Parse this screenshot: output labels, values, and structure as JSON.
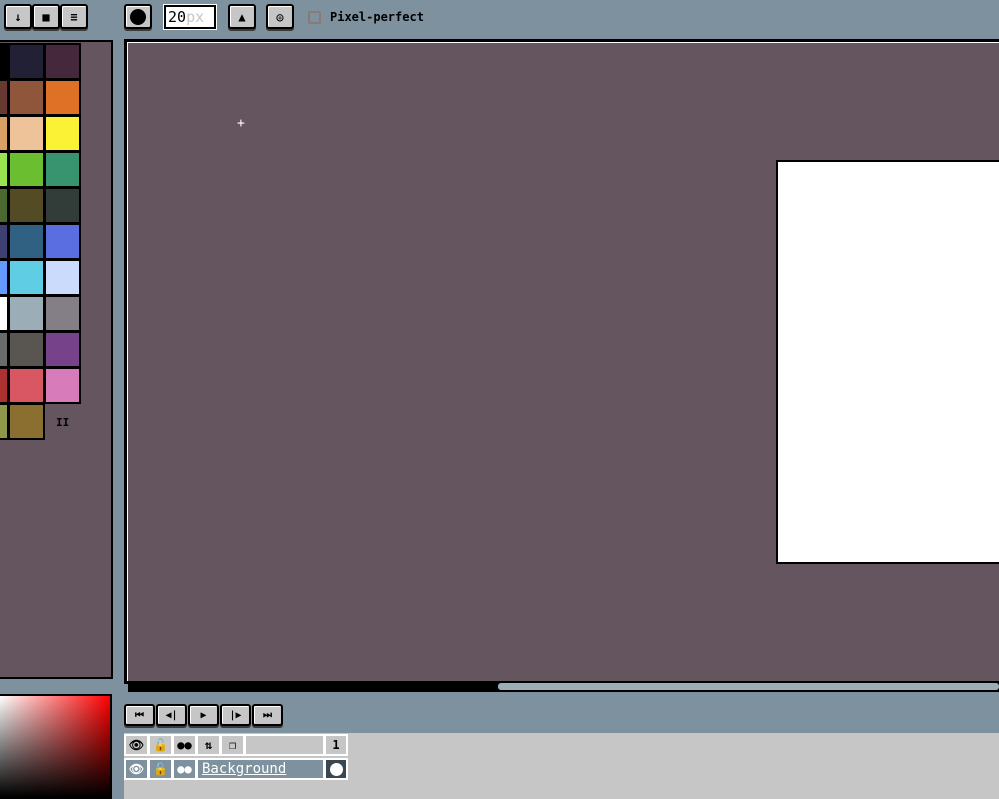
{
  "toolbar": {
    "buttons": [
      "↓",
      "■",
      "≡"
    ],
    "brush_size": "20",
    "brush_unit": "px",
    "pixel_perfect_label": "Pixel-perfect",
    "pixel_perfect_checked": false
  },
  "palette": {
    "colors": [
      [
        "#000000",
        "#222034",
        "#45283c"
      ],
      [
        "#663931",
        "#8f563b",
        "#df7126"
      ],
      [
        "#d9a066",
        "#eec39a",
        "#fbf236"
      ],
      [
        "#99e550",
        "#6abe30",
        "#37946e"
      ],
      [
        "#4b692f",
        "#524b24",
        "#323c39"
      ],
      [
        "#3f3f74",
        "#306082",
        "#5b6ee1"
      ],
      [
        "#639bff",
        "#5fcde4",
        "#cbdbfc"
      ],
      [
        "#ffffff",
        "#9badb7",
        "#847e87"
      ],
      [
        "#696a6a",
        "#595652",
        "#76428a"
      ],
      [
        "#ac3232",
        "#d95763",
        "#d77bba"
      ],
      [
        "#8f974a",
        "#8a6f30",
        null
      ]
    ],
    "drag_handle": "II"
  },
  "timeline": {
    "controls": [
      "⏮",
      "◀|",
      "▶",
      "|▶",
      "⏭"
    ],
    "header_icons": [
      "eye-icon",
      "lock-icon",
      "onion-icon",
      "link-icon",
      "layers-icon"
    ],
    "frame_number": "1",
    "layers": [
      {
        "name": "Background"
      }
    ]
  },
  "colors": {
    "bg": "#7d929e",
    "canvas_bg": "#65555f",
    "panel": "#c6c6c6"
  }
}
